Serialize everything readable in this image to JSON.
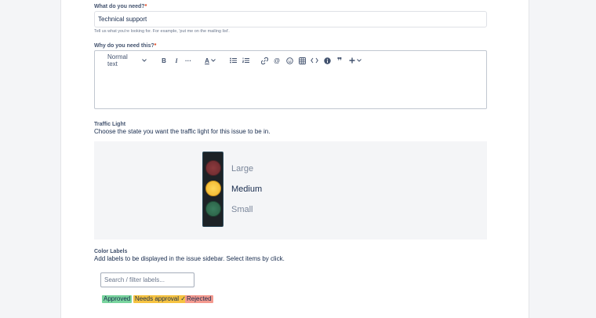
{
  "need_field": {
    "label": "What do you need?",
    "required_mark": "*",
    "value": "Technical support",
    "help": "Tell us what you're looking for. For example, 'put me on the mailing list'."
  },
  "why_field": {
    "label": "Why do you need this?",
    "required_mark": "*",
    "toolbar": {
      "text_style": "Normal text",
      "icons": [
        "chevron-down-icon",
        "bold-icon",
        "italic-icon",
        "more-icon",
        "text-color-icon",
        "bullet-list-icon",
        "numbered-list-icon",
        "link-icon",
        "mention-icon",
        "emoji-icon",
        "table-icon",
        "code-icon",
        "info-icon",
        "quote-icon",
        "insert-icon"
      ]
    }
  },
  "traffic_light": {
    "title": "Traffic Light",
    "description": "Choose the state you want the traffic light for this issue to be in.",
    "options": [
      "Large",
      "Medium",
      "Small"
    ],
    "selected": "Medium",
    "colors": {
      "red": "#7a2f33",
      "yellow": "#f6c12b",
      "green": "#2f6b50",
      "housing": "#1d2226"
    }
  },
  "color_labels": {
    "title": "Color Labels",
    "description": "Add labels to be displayed in the issue sidebar. Select items by click.",
    "search_placeholder": "Search / filter labels...",
    "labels": [
      {
        "text": "Approved",
        "color": "#79d49e",
        "selected": false
      },
      {
        "text": "Needs approval",
        "color": "#f6c342",
        "selected": true,
        "check": "✓"
      },
      {
        "text": "Rejected",
        "color": "#f49a8f",
        "selected": false
      }
    ]
  }
}
